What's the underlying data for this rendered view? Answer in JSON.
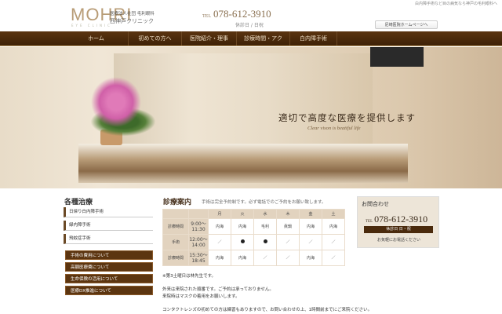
{
  "header": {
    "tagline": "白内障手術など目の病気なら神戸の毛利眼科へ",
    "logo": "MOHRI",
    "logo_sub": "EYE CLINIC",
    "clinic_corp": "医療法人社団 毛利眼科",
    "clinic_name": "西神戸クリニック",
    "tel_label": "TEL",
    "tel": "078-612-3910",
    "closed": "休診日 / 日祝",
    "hp_button": "尼崎医院ホームページへ"
  },
  "nav": [
    "ホーム",
    "初めての方へ",
    "医院紹介・理事長挨拶",
    "診療時間・アクセス",
    "白内障手術"
  ],
  "hero": {
    "title": "適切で高度な医療を提供します",
    "subtitle": "Clear vison is beatiful life"
  },
  "sidebar": {
    "title": "各種治療",
    "links": [
      "日帰り白内障手術",
      "緑内障手術",
      "飛蚊症手術"
    ],
    "buttons": [
      "手術の費用について",
      "高額医療費について",
      "生命保険の活用について",
      "医療DX推進について"
    ]
  },
  "schedule": {
    "title": "診療案内",
    "note": "手術は完全予約制です。必ず電話でのご予約をお願い致します。",
    "days": [
      "月",
      "火",
      "水",
      "木",
      "金",
      "土"
    ],
    "rows": [
      {
        "label": "診療時間",
        "time": "9:00〜11:30",
        "cells": [
          "内海",
          "内海",
          "毛利",
          "眞鍋",
          "内海",
          "内海"
        ]
      },
      {
        "label": "手術",
        "time": "12:00〜14:00",
        "cells": [
          "／",
          "●",
          "●",
          "／",
          "／",
          "／"
        ]
      },
      {
        "label": "診療時間",
        "time": "15:30〜18:45",
        "cells": [
          "内海",
          "内海",
          "／",
          "／",
          "内海",
          "／"
        ]
      }
    ],
    "notes": [
      "※第3土曜日は林先生です。",
      "外来は来院された順番です。ご予約は承っておりません。",
      "来院時はマスクの着用をお願いします。",
      "コンタクトレンズの初めての方は練習もありますので、お問い合わせの上、1時間前までにご来院ください。"
    ]
  },
  "contact": {
    "title": "お問合わせ",
    "tel_label": "TEL",
    "tel": "078-612-3910",
    "hours": "休診日 日・祝",
    "message": "お気軽にお電話ください"
  }
}
